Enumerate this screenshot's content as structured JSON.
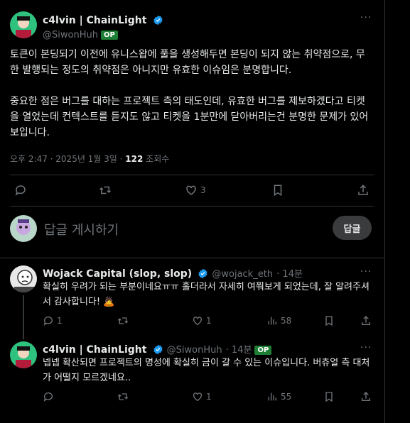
{
  "main_post": {
    "display_name": "c4lvin | ChainLight",
    "handle": "@SiwonHuh",
    "badge": "OP",
    "paragraph1": "토큰이 본딩되기 이전에 유니스왑에 풀을 생성해두면 본딩이 되지 않는 취약점으로, 무한 발행되는 정도의 취약점은 아니지만 유효한 이슈임은 분명합니다.",
    "paragraph2": "중요한 점은 버그를 대하는 프로젝트 측의 태도인데, 유효한 버그를 제보하겠다고 티켓을 열었는데 컨텍스트를 듣지도 않고 티켓을 1분만에 닫아버리는건 분명한 문제가 있어 보입니다.",
    "time": "오후 2:47 · 2025년 1월 3일 · ",
    "views": "122",
    "views_label": " 조회수",
    "likes": "3"
  },
  "compose": {
    "placeholder": "답글 게시하기",
    "button_label": "답글"
  },
  "replies": [
    {
      "display_name": "Wojack Capital (slop, slop)",
      "handle": "@wojack_eth",
      "time": "· 14분",
      "text": "확실히 우려가 되는 부분이네요ㅠㅠ 홀더라서 자세히 여쭤보게 되었는데, 잘 알려주셔서 감사합니다! 🙇",
      "replies_count": "1",
      "likes": "1",
      "views": "58"
    },
    {
      "display_name": "c4lvin | ChainLight",
      "handle": "@SiwonHuh",
      "time": "· 14분",
      "badge": "OP",
      "text": "넵넵 확산되면 프로젝트의 명성에 확실히 금이 갈 수 있는 이슈입니다. 버츄얼 측 대처가 어떨지 모르겠네요..",
      "likes": "1",
      "views": "55"
    }
  ],
  "colors": {
    "background": "#000000",
    "text": "#e7e9ea",
    "muted": "#71767b",
    "verified": "#1d9bf0",
    "op_badge": "#1e7e34",
    "divider": "#2f3336"
  },
  "icons": [
    "verified-icon",
    "more-icon",
    "reply-icon",
    "retweet-icon",
    "like-icon",
    "bookmark-icon",
    "share-icon",
    "views-icon"
  ]
}
